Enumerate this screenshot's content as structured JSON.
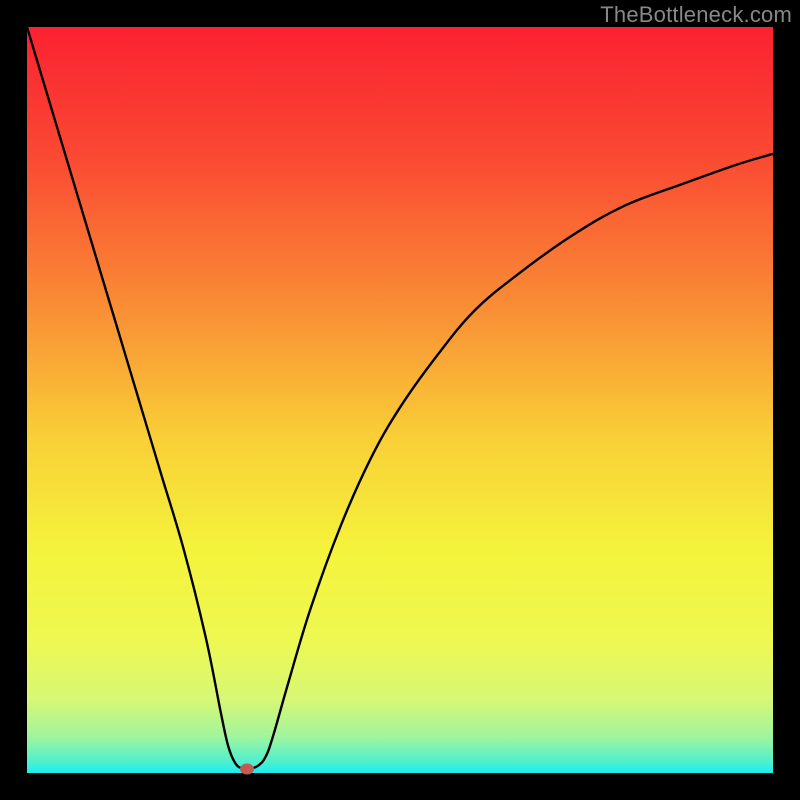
{
  "watermark": "TheBottleneck.com",
  "layout": {
    "image_size": 800,
    "border": 27,
    "plot_size": 746
  },
  "colors": {
    "frame": "#000000",
    "curve_stroke": "#000000",
    "marker_fill": "#c65a52",
    "gradient_stops": [
      {
        "pos": 0.0,
        "color": "#fb2131"
      },
      {
        "pos": 0.18,
        "color": "#fa4b33"
      },
      {
        "pos": 0.38,
        "color": "#f98f35"
      },
      {
        "pos": 0.55,
        "color": "#f9cf37"
      },
      {
        "pos": 0.7,
        "color": "#f4f33b"
      },
      {
        "pos": 0.82,
        "color": "#eef851"
      },
      {
        "pos": 0.9,
        "color": "#d8f774"
      },
      {
        "pos": 0.95,
        "color": "#a2f59d"
      },
      {
        "pos": 0.985,
        "color": "#4ef0cf"
      },
      {
        "pos": 1.0,
        "color": "#19eef0"
      }
    ]
  },
  "chart_data": {
    "type": "line",
    "title": "",
    "xlabel": "",
    "ylabel": "",
    "xlim": [
      0,
      100
    ],
    "ylim": [
      0,
      100
    ],
    "grid": false,
    "series": [
      {
        "name": "bottleneck-curve",
        "x": [
          0,
          3,
          6,
          9,
          12,
          15,
          18,
          21,
          24,
          26,
          27,
          28,
          29,
          30,
          31,
          32,
          33,
          35,
          38,
          42,
          46,
          50,
          55,
          60,
          66,
          73,
          80,
          88,
          95,
          100
        ],
        "y": [
          100,
          90,
          80,
          70,
          60,
          50,
          40,
          30,
          18,
          8,
          3.5,
          1.2,
          0.6,
          0.6,
          1.0,
          2.2,
          5,
          12,
          22,
          33,
          42,
          49,
          56,
          62,
          67,
          72,
          76,
          79,
          81.5,
          83
        ]
      }
    ],
    "annotations": [
      {
        "name": "min-marker",
        "x": 29.5,
        "y": 0.6
      }
    ]
  }
}
